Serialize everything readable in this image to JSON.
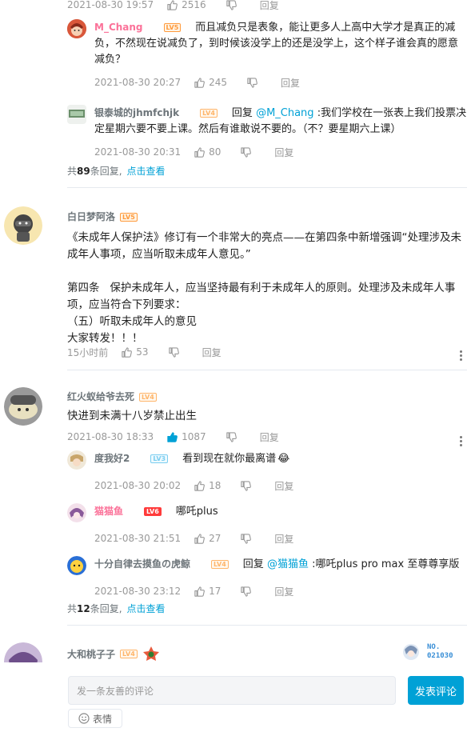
{
  "top_fragment": {
    "time": "2021-08-30 19:57",
    "likes": "2516",
    "reply": "回复"
  },
  "thread1": {
    "replies": [
      {
        "user": "M_Chang",
        "level": "LV5",
        "text": "而且减负只是表象，能让更多人上高中大学才是真正的减负，不然现在说减负了，到时候该没学上的还是没学上，这个样子谁会真的愿意减负？",
        "time": "2021-08-30 20:27",
        "likes": "245",
        "reply": "回复"
      },
      {
        "user": "银泰城的jhmfchjk",
        "level": "LV4",
        "reply_prefix": "回复",
        "at": "@M_Chang",
        "text": ":我们学校在一张表上我们投票决定星期六要不要上课。然后有谁敢说不要的。（不？要星期六上课）",
        "time": "2021-08-30 20:31",
        "likes": "80",
        "reply": "回复"
      }
    ],
    "total_prefix": "共",
    "total_count": "89",
    "total_suffix": "条回复,",
    "view_more": "点击查看"
  },
  "comment2": {
    "user": "白日梦阿洛",
    "level": "LV5",
    "text": "《未成年人保护法》修订有一个非常大的亮点——在第四条中新增强调“处理涉及未成年人事项，应当听取未成年人意见。”\n\n第四条   保护未成年人，应当坚持最有利于未成年人的原则。处理涉及未成年人事项，应当符合下列要求：\n（五）听取未成年人的意见\n大家转发！！！",
    "time": "15小时前",
    "likes": "53",
    "reply": "回复"
  },
  "comment3": {
    "user": "红火蚁给爷去死",
    "level": "LV4",
    "text": "快进到未满十八岁禁止出生",
    "time": "2021-08-30 18:33",
    "likes": "1087",
    "reply": "回复",
    "replies": [
      {
        "user": "度我好2",
        "level": "LV3",
        "text": "看到现在就你最离谱",
        "emoji": "😂",
        "time": "2021-08-30 20:02",
        "likes": "18",
        "reply": "回复"
      },
      {
        "user": "猫猫鱼",
        "level": "LV6",
        "text": "哪吒plus",
        "time": "2021-08-30 21:51",
        "likes": "27",
        "reply": "回复"
      },
      {
        "user": "十分自律去摸鱼の虎鲸",
        "level": "LV4",
        "reply_prefix": "回复",
        "at": "@猫猫鱼",
        "text": ":哪吒plus pro max 至尊尊享版",
        "time": "2021-08-30 23:12",
        "likes": "17",
        "reply": "回复"
      }
    ],
    "total_prefix": "共",
    "total_count": "12",
    "total_suffix": "条回复,",
    "view_more": "点击查看"
  },
  "comment4": {
    "user": "大和桃子子",
    "level": "LV4",
    "badge_text": "NO.\n021030"
  },
  "composer": {
    "placeholder": "发一条友善的评论",
    "submit": "发表评论",
    "emoji": "表情"
  },
  "colors": {
    "accent": "#00a1d6",
    "pink_name": "#fb7299",
    "liked": "#00a1d6"
  }
}
